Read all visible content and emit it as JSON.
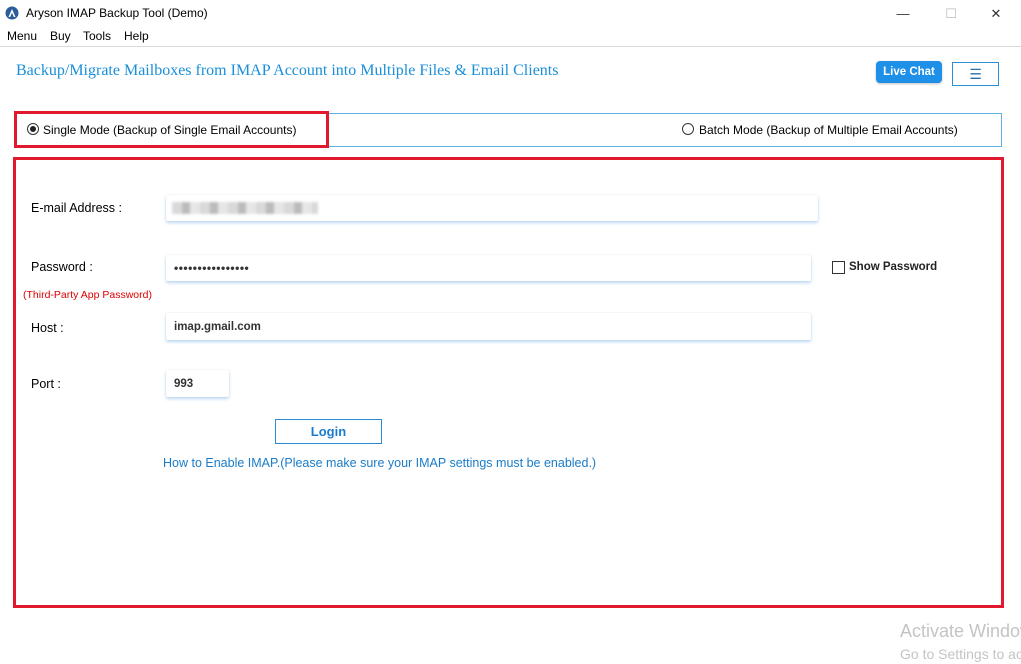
{
  "window": {
    "title": "Aryson IMAP Backup Tool (Demo)",
    "controls": {
      "minimize": "—",
      "maximize": "☐",
      "close": "✕"
    }
  },
  "menu": [
    "Menu",
    "Buy",
    "Tools",
    "Help"
  ],
  "header": {
    "title": "Backup/Migrate Mailboxes from IMAP Account into Multiple Files & Email Clients",
    "live_chat": "Live Chat",
    "menu_toggle_icon": "hamburger-icon"
  },
  "modes": {
    "single": "Single Mode (Backup of Single Email Accounts)",
    "batch": "Batch Mode (Backup of Multiple Email Accounts)",
    "selected": "single"
  },
  "form": {
    "email_label": "E-mail Address :",
    "email_value": "",
    "password_label": "Password :",
    "password_hint": "(Third-Party App Password)",
    "password_value": "••••••••••••••••",
    "show_password_label": "Show Password",
    "host_label": "Host :",
    "host_value": "imap.gmail.com",
    "port_label": "Port :",
    "port_value": "993",
    "login_label": "Login",
    "help_link": "How to Enable IMAP.(Please make sure your IMAP settings must be enabled.)"
  },
  "watermark": {
    "line1": "Activate Windows",
    "line2": "Go to Settings to activate Windows."
  },
  "colors": {
    "accent": "#1e90e8",
    "highlight_border": "#e0192e",
    "hint_red": "#dd0000"
  }
}
